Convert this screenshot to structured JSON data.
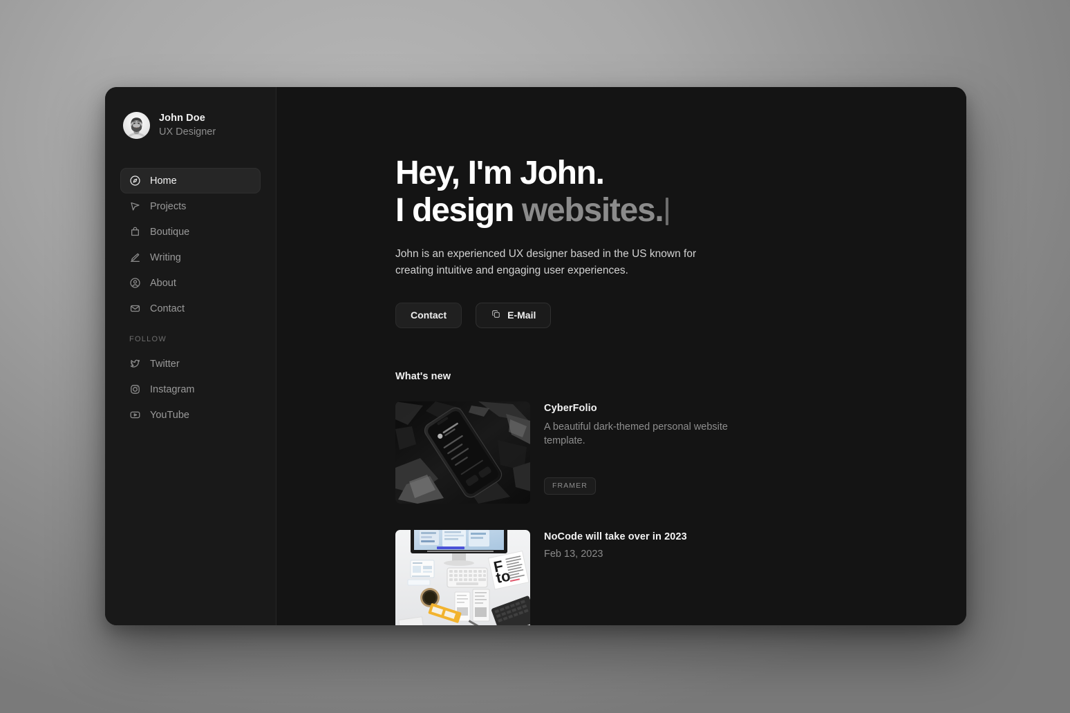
{
  "profile": {
    "name": "John Doe",
    "role": "UX Designer",
    "avatar_icon": "user-photo-avatar"
  },
  "sidebar": {
    "nav_items": [
      {
        "label": "Home",
        "icon": "compass-icon",
        "active": true
      },
      {
        "label": "Projects",
        "icon": "cursor-arrow-icon",
        "active": false
      },
      {
        "label": "Boutique",
        "icon": "shopping-bag-icon",
        "active": false
      },
      {
        "label": "Writing",
        "icon": "pencil-icon",
        "active": false
      },
      {
        "label": "About",
        "icon": "user-circle-icon",
        "active": false
      },
      {
        "label": "Contact",
        "icon": "envelope-icon",
        "active": false
      }
    ],
    "follow_label": "FOLLOW",
    "social_items": [
      {
        "label": "Twitter",
        "icon": "twitter-icon"
      },
      {
        "label": "Instagram",
        "icon": "instagram-icon"
      },
      {
        "label": "YouTube",
        "icon": "youtube-icon"
      }
    ]
  },
  "hero": {
    "line1": "Hey, I'm John.",
    "line2_prefix": "I design ",
    "line2_accent": "websites.",
    "subtitle": "John is an experienced UX designer based in the US known for creating intuitive and engaging user experiences.",
    "buttons": [
      {
        "label": "Contact",
        "icon": null
      },
      {
        "label": "E-Mail",
        "icon": "copy-icon"
      }
    ]
  },
  "whats_new": {
    "title": "What's new",
    "items": [
      {
        "title": "CyberFolio",
        "description": "A beautiful dark-themed personal website template.",
        "tag": "FRAMER",
        "date": null,
        "thumb": "dark-phone-on-rocks-photo"
      },
      {
        "title": "NoCode will take over in 2023",
        "description": null,
        "tag": null,
        "date": "Feb 13, 2023",
        "thumb": "desk-workspace-imac-photo"
      }
    ]
  },
  "colors": {
    "window_bg": "#141414",
    "sidebar_bg": "#191919",
    "active_item_bg": "#262626",
    "text_primary": "#f2f2f2",
    "text_muted": "#8e8e8e",
    "accent_gray": "#8b8b8b"
  }
}
